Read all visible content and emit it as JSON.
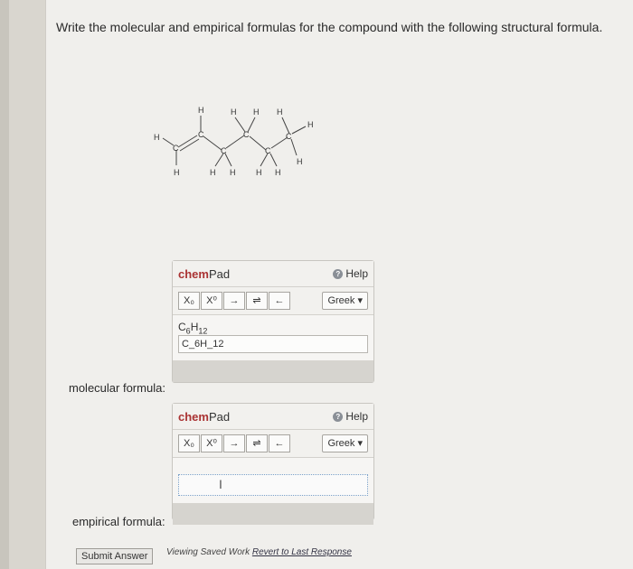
{
  "question": "Write the molecular and empirical formulas for the compound with the following structural formula.",
  "structure": {
    "atoms_h": [
      "H",
      "H",
      "H",
      "H",
      "H",
      "H",
      "H",
      "H",
      "H",
      "H",
      "H",
      "H"
    ],
    "atoms_c": [
      "C",
      "C",
      "C",
      "C",
      "C",
      "C"
    ]
  },
  "molecular": {
    "label": "molecular formula:",
    "chempad_title_bold": "chem",
    "chempad_title_rest": "Pad",
    "help_label": "Help",
    "greek_label": "Greek",
    "tools": [
      "X₀",
      "X⁰",
      "→",
      "⇌",
      "←"
    ],
    "preview": {
      "c": "C",
      "c_n": "6",
      "h": "H",
      "h_n": "12"
    },
    "input_value": "C_6H_12"
  },
  "empirical": {
    "label": "empirical formula:",
    "chempad_title_bold": "chem",
    "chempad_title_rest": "Pad",
    "help_label": "Help",
    "greek_label": "Greek",
    "tools": [
      "X₀",
      "X⁰",
      "→",
      "⇌",
      "←"
    ],
    "input_value": ""
  },
  "footer": {
    "submit_label": "Submit Answer",
    "viewing_text": "Viewing Saved Work",
    "revert_text": "Revert to Last Response"
  }
}
